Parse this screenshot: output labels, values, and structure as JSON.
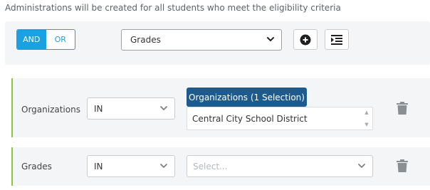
{
  "intro_text": "Administrations will be created for all students who meet the eligibility criteria",
  "toolbar": {
    "logic": {
      "and_label": "AND",
      "or_label": "OR",
      "selected": "AND"
    },
    "field_select_value": "Grades",
    "add_icon": "plus-circle-icon",
    "indent_icon": "indent-icon"
  },
  "rules": [
    {
      "label": "Organizations",
      "operator": "IN",
      "selection_header": "Organizations (1 Selection)",
      "selected_value": "Central City School District",
      "delete_icon": "trash-icon"
    },
    {
      "label": "Grades",
      "operator": "IN",
      "placeholder": "Select...",
      "delete_icon": "trash-icon"
    }
  ],
  "colors": {
    "accent": "#1ba0e2",
    "header_blue": "#1d5b8f",
    "rule_border": "#8cc63f",
    "panel_bg": "#f4f5f6"
  }
}
